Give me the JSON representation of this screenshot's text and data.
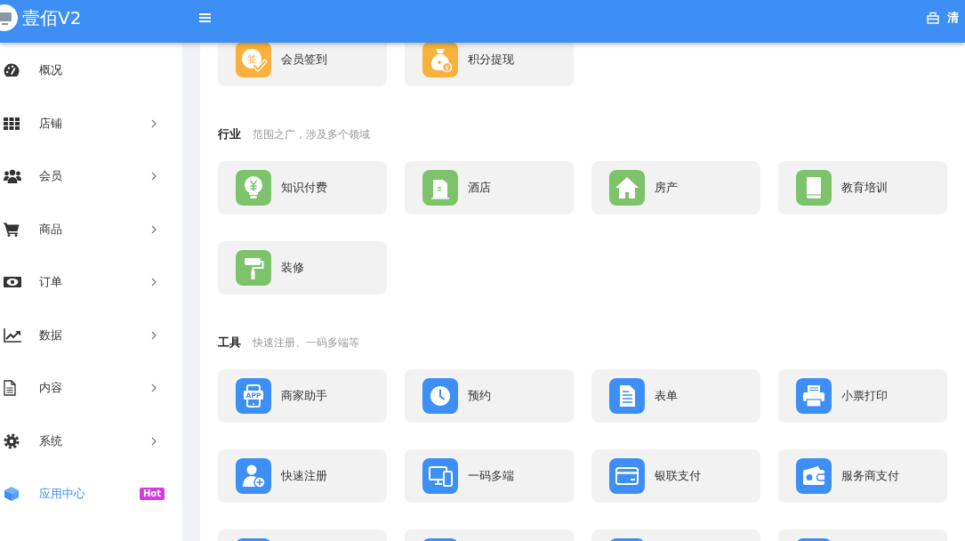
{
  "header": {
    "logo_text": "壹佰V2",
    "action": {
      "label": "清"
    }
  },
  "sidebar": {
    "items": [
      {
        "label": "概况",
        "kind": "dashboard",
        "expandable": false,
        "selected": false
      },
      {
        "label": "店铺",
        "kind": "grid",
        "expandable": true,
        "selected": false
      },
      {
        "label": "会员",
        "kind": "users",
        "expandable": true,
        "selected": false
      },
      {
        "label": "商品",
        "kind": "cart",
        "expandable": true,
        "selected": false
      },
      {
        "label": "订单",
        "kind": "banknote",
        "expandable": true,
        "selected": false
      },
      {
        "label": "数据",
        "kind": "chart",
        "expandable": true,
        "selected": false
      },
      {
        "label": "内容",
        "kind": "document",
        "expandable": true,
        "selected": false
      },
      {
        "label": "系统",
        "kind": "gear",
        "expandable": true,
        "selected": false
      },
      {
        "label": "应用中心",
        "kind": "cube",
        "expandable": false,
        "selected": true,
        "badge": "Hot"
      }
    ]
  },
  "sections": [
    {
      "color": "#f8b13c",
      "items": [
        {
          "label": "会员签到",
          "kind": "sign-in",
          "icon_text": "签"
        },
        {
          "label": "积分提现",
          "kind": "money-bag"
        }
      ]
    },
    {
      "title": "行业",
      "subtitle": "范围之广，涉及多个领域",
      "color": "#7dc36c",
      "items": [
        {
          "label": "知识付费",
          "kind": "bulb"
        },
        {
          "label": "酒店",
          "kind": "building"
        },
        {
          "label": "房产",
          "kind": "house"
        },
        {
          "label": "教育培训",
          "kind": "book"
        },
        {
          "label": "装修",
          "kind": "roller"
        }
      ]
    },
    {
      "title": "工具",
      "subtitle": "快速注册、一码多端等",
      "color": "#3d8ef5",
      "items": [
        {
          "label": "商家助手",
          "kind": "phone-app",
          "icon_text": "APP"
        },
        {
          "label": "预约",
          "kind": "clock"
        },
        {
          "label": "表单",
          "kind": "form"
        },
        {
          "label": "小票打印",
          "kind": "printer"
        },
        {
          "label": "快速注册",
          "kind": "user-add"
        },
        {
          "label": "一码多端",
          "kind": "devices"
        },
        {
          "label": "银联支付",
          "kind": "card"
        },
        {
          "label": "服务商支付",
          "kind": "wallet"
        },
        {
          "kind": "tile"
        },
        {
          "kind": "tile"
        },
        {
          "kind": "tile"
        },
        {
          "kind": "tile"
        }
      ]
    }
  ]
}
